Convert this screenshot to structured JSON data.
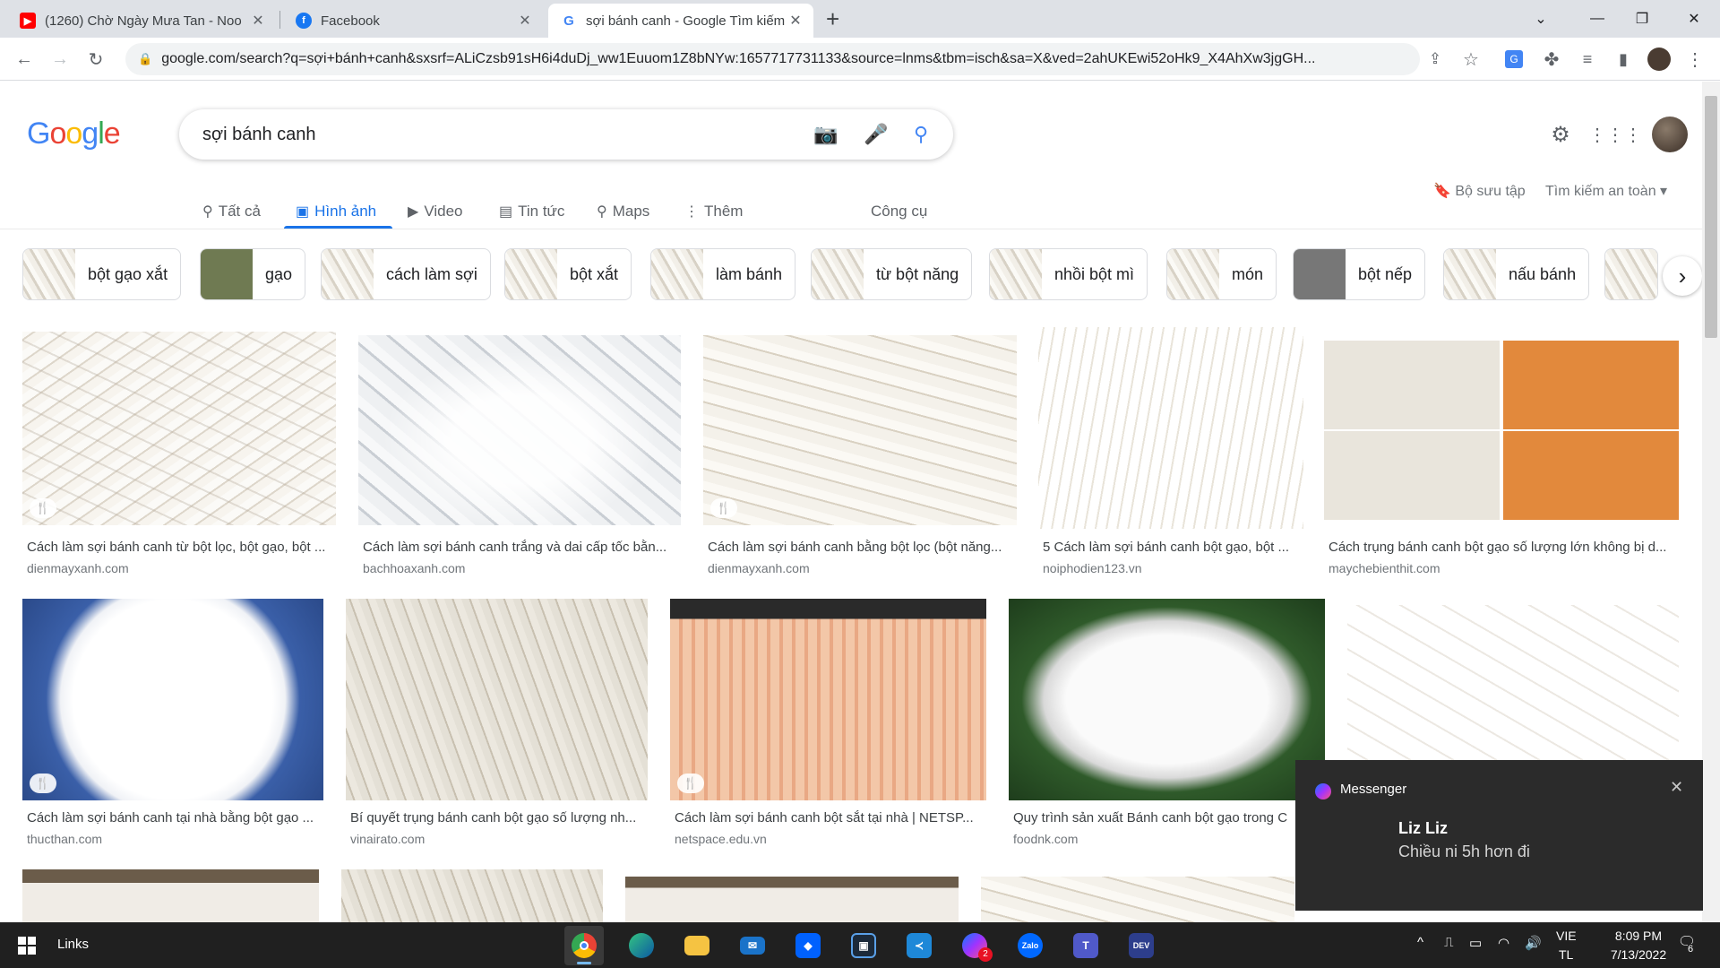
{
  "browser": {
    "tabs": [
      {
        "title": "(1260) Chờ Ngày Mưa Tan - Noo",
        "favicon": "youtube-icon",
        "color": "#ff0000"
      },
      {
        "title": "Facebook",
        "favicon": "facebook-icon",
        "color": "#1877f2"
      },
      {
        "title": "sợi bánh canh - Google Tìm kiếm",
        "favicon": "google-icon",
        "color": "#4285f4"
      }
    ],
    "new_tab_symbol": "+",
    "url": "google.com/search?q=sợi+bánh+canh&sxsrf=ALiCzsb91sH6i4duDj_ww1Euuom1Z8bNYw:1657717731133&source=lnms&tbm=isch&sa=X&ved=2ahUKEwi52oHk9_X4AhXw3jgGH..."
  },
  "google": {
    "logo": [
      "G",
      "o",
      "o",
      "g",
      "l",
      "e"
    ],
    "query": "sợi bánh canh",
    "nav": [
      {
        "label": "Tất cả",
        "icon": "search-icon",
        "glyph": "🔍"
      },
      {
        "label": "Hình ảnh",
        "icon": "image-icon",
        "glyph": "🖼"
      },
      {
        "label": "Video",
        "icon": "video-icon",
        "glyph": "▶"
      },
      {
        "label": "Tin tức",
        "icon": "news-icon",
        "glyph": "▤"
      },
      {
        "label": "Maps",
        "icon": "map-pin-icon",
        "glyph": "⚲"
      },
      {
        "label": "Thêm",
        "icon": "more-icon",
        "glyph": "⋮"
      }
    ],
    "tools": "Công cụ",
    "collections": "Bộ sưu tập",
    "safe_search": "Tìm kiếm an toàn ▾",
    "chips": [
      "bột gạo xắt",
      "gạo",
      "cách làm sợi",
      "bột xắt",
      "làm bánh",
      "từ bột năng",
      "nhồi bột mì",
      "món",
      "bột nếp",
      "nấu bánh"
    ],
    "results": [
      {
        "caption": "Cách làm sợi bánh canh từ bột lọc, bột gạo, bột ...",
        "source": "dienmayxanh.com",
        "badge": "🍴"
      },
      {
        "caption": "Cách làm sợi bánh canh trắng và dai cấp tốc bằn...",
        "source": "bachhoaxanh.com",
        "badge": ""
      },
      {
        "caption": "Cách làm sợi bánh canh bằng bột lọc (bột năng...",
        "source": "dienmayxanh.com",
        "badge": "🍴"
      },
      {
        "caption": "5 Cách làm sợi bánh canh bột gạo, bột ...",
        "source": "noiphodien123.vn",
        "badge": ""
      },
      {
        "caption": "Cách trụng bánh canh bột gạo số lượng lớn không bị d...",
        "source": "maychebienthit.com",
        "badge": ""
      },
      {
        "caption": "Cách làm sợi bánh canh tại nhà bằng bột gạo ...",
        "source": "thucthan.com",
        "badge": "🍴"
      },
      {
        "caption": "Bí quyết trụng bánh canh bột gạo số lượng nh...",
        "source": "vinairato.com",
        "badge": ""
      },
      {
        "caption": "Cách làm sợi bánh canh bột sắt tại nhà | NETSP...",
        "source": "netspace.edu.vn",
        "badge": "🍴"
      },
      {
        "caption": "Quy trình sản xuất Bánh canh bột gạo trong C",
        "source": "foodnk.com",
        "badge": ""
      },
      {
        "caption": "",
        "source": "",
        "badge": ""
      }
    ]
  },
  "toast": {
    "app": "Messenger",
    "sender": "Liz Liz",
    "message": "Chiều ni 5h hơn đi",
    "close": "✕"
  },
  "taskbar": {
    "links": "Links",
    "lang1": "VIE",
    "lang2": "TL",
    "time": "8:09 PM",
    "date": "7/13/2022",
    "notif_count": "6",
    "messenger_badge": "2"
  }
}
